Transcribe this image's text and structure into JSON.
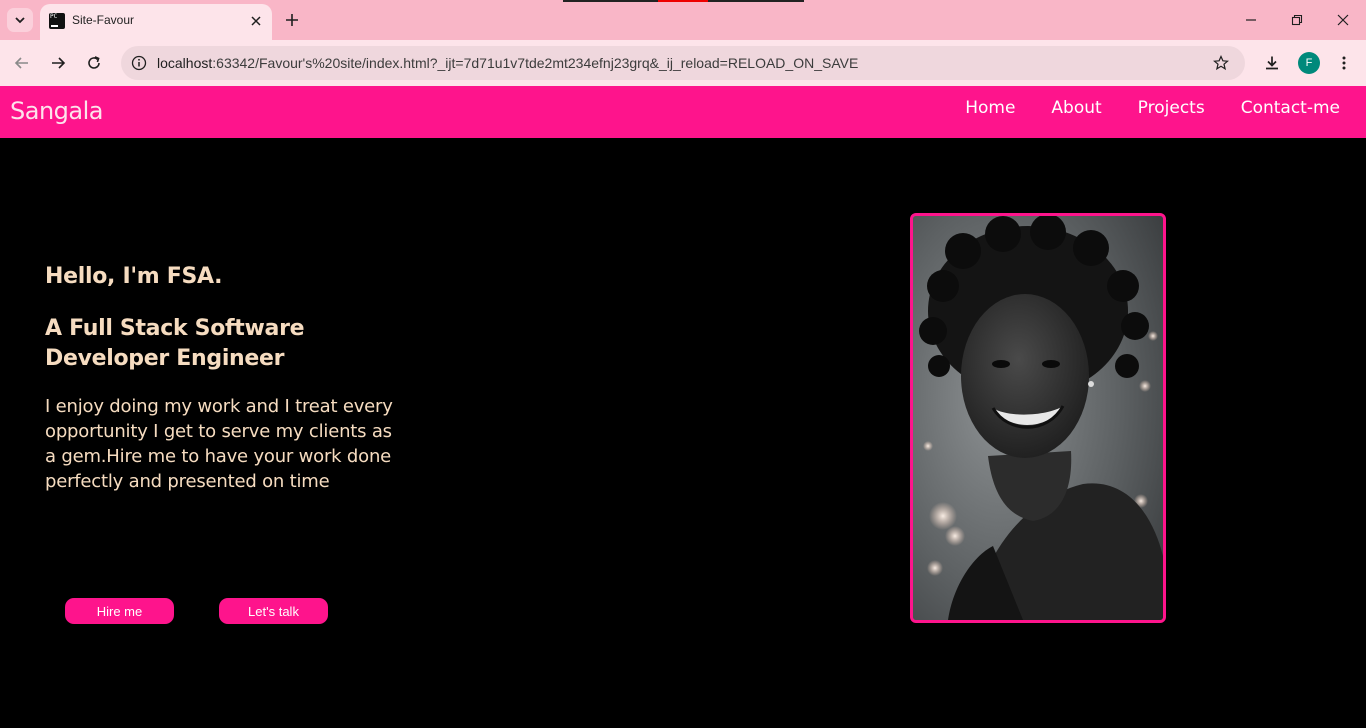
{
  "browser": {
    "tab_title": "Site-Favour",
    "url_host": "localhost",
    "url_rest": ":63342/Favour's%20site/index.html?_ijt=7d71u1v7tde2mt234efnj23grq&_ij_reload=RELOAD_ON_SAVE",
    "profile_initial": "F"
  },
  "site": {
    "brand": "Sangala",
    "nav": [
      "Home",
      "About",
      "Projects",
      "Contact-me"
    ]
  },
  "hero": {
    "greeting": "Hello, I'm FSA.",
    "role": "A Full Stack Software Developer Engineer",
    "description": "I enjoy doing my work and I treat every opportunity I get to serve my clients as a gem.Hire me to have your work done perfectly and presented on time",
    "buttons": [
      "Hire me",
      "Let's talk"
    ]
  },
  "colors": {
    "accent": "#fe148c",
    "text": "#f6dcc0",
    "background": "#000000"
  }
}
